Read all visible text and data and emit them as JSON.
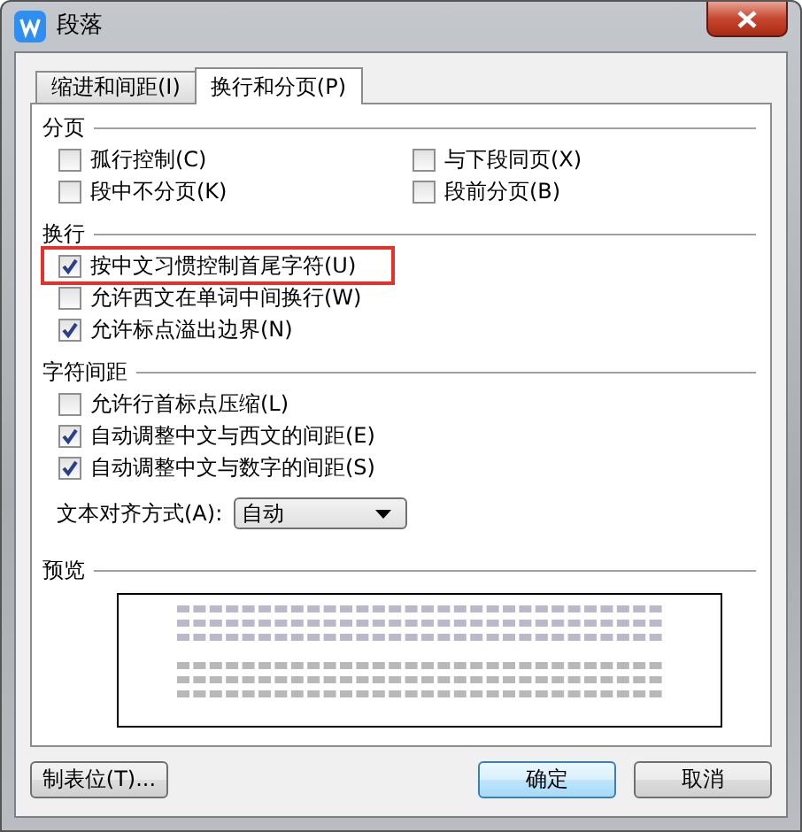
{
  "window": {
    "title": "段落"
  },
  "tabs": [
    {
      "label": "缩进和间距(I)",
      "selected": false
    },
    {
      "label": "换行和分页(P)",
      "selected": true
    }
  ],
  "groups": [
    {
      "title": "分页",
      "kind": "grid",
      "options": [
        {
          "label": "孤行控制(C)",
          "checked": false,
          "highlighted": false
        },
        {
          "label": "与下段同页(X)",
          "checked": false,
          "highlighted": false
        },
        {
          "label": "段中不分页(K)",
          "checked": false,
          "highlighted": false
        },
        {
          "label": "段前分页(B)",
          "checked": false,
          "highlighted": false
        }
      ]
    },
    {
      "title": "换行",
      "kind": "list",
      "options": [
        {
          "label": "按中文习惯控制首尾字符(U)",
          "checked": true,
          "highlighted": true
        },
        {
          "label": "允许西文在单词中间换行(W)",
          "checked": false,
          "highlighted": false
        },
        {
          "label": "允许标点溢出边界(N)",
          "checked": true,
          "highlighted": false
        }
      ]
    },
    {
      "title": "字符间距",
      "kind": "list",
      "options": [
        {
          "label": "允许行首标点压缩(L)",
          "checked": false,
          "highlighted": false
        },
        {
          "label": "自动调整中文与西文的间距(E)",
          "checked": true,
          "highlighted": false
        },
        {
          "label": "自动调整中文与数字的间距(S)",
          "checked": true,
          "highlighted": false
        }
      ]
    }
  ],
  "alignment": {
    "label": "文本对齐方式(A):",
    "value": "自动"
  },
  "preview": {
    "title": "预览"
  },
  "buttons": [
    {
      "label": "制表位(T)...",
      "kind": "normal"
    },
    {
      "label": "确定",
      "kind": "default"
    },
    {
      "label": "取消",
      "kind": "normal"
    }
  ]
}
